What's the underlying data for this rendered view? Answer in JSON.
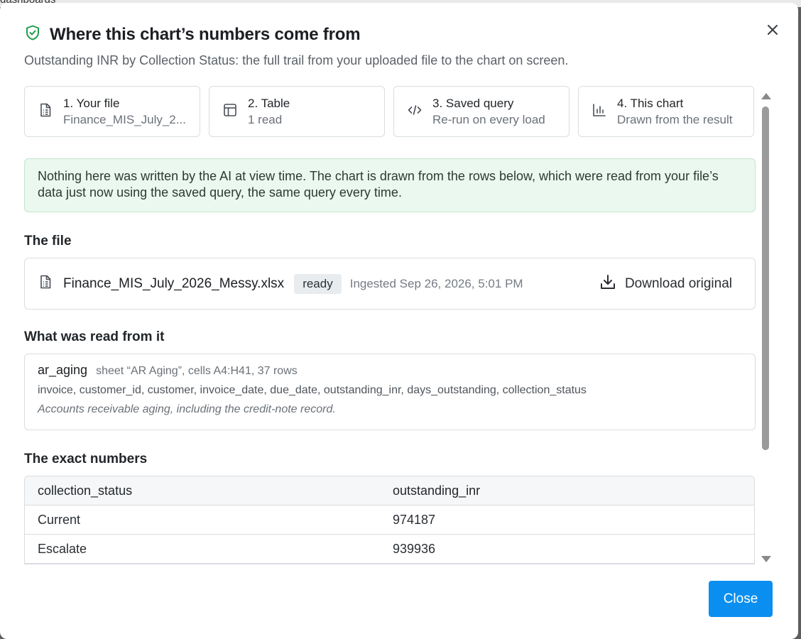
{
  "backdrop": {
    "text": "dashboards"
  },
  "dialog": {
    "title": "Where this chart’s numbers come from",
    "subtitle": "Outstanding INR by Collection Status: the full trail from your uploaded file to the chart on screen.",
    "accent_color": "#1e9e4a",
    "primary_color": "#0a8ef0"
  },
  "steps": [
    {
      "title": "1. Your file",
      "sub": "Finance_MIS_July_2...",
      "icon": "file-icon"
    },
    {
      "title": "2. Table",
      "sub": "1 read",
      "icon": "table-icon"
    },
    {
      "title": "3. Saved query",
      "sub": "Re-run on every load",
      "icon": "code-icon"
    },
    {
      "title": "4. This chart",
      "sub": "Drawn from the result",
      "icon": "chart-icon"
    }
  ],
  "notice": "Nothing here was written by the AI at view time. The chart is drawn from the rows below, which were read from your file’s data just now using the saved query, the same query every time.",
  "file_section": {
    "label": "The file",
    "name": "Finance_MIS_July_2026_Messy.xlsx",
    "status": "ready",
    "ingested": "Ingested Sep 26, 2026, 5:01 PM",
    "download_label": "Download original"
  },
  "read_section": {
    "label": "What was read from it",
    "table_name": "ar_aging",
    "sheet_info": "sheet “AR Aging”, cells A4:H41, 37 rows",
    "columns": "invoice, customer_id, customer, invoice_date, due_date, outstanding_inr, days_outstanding, collection_status",
    "description": "Accounts receivable aging, including the credit-note record."
  },
  "numbers_section": {
    "label": "The exact numbers",
    "headers": [
      "collection_status",
      "outstanding_inr"
    ],
    "rows": [
      [
        "Current",
        "974187"
      ],
      [
        "Escalate",
        "939936"
      ]
    ]
  },
  "footer": {
    "close_label": "Close"
  }
}
